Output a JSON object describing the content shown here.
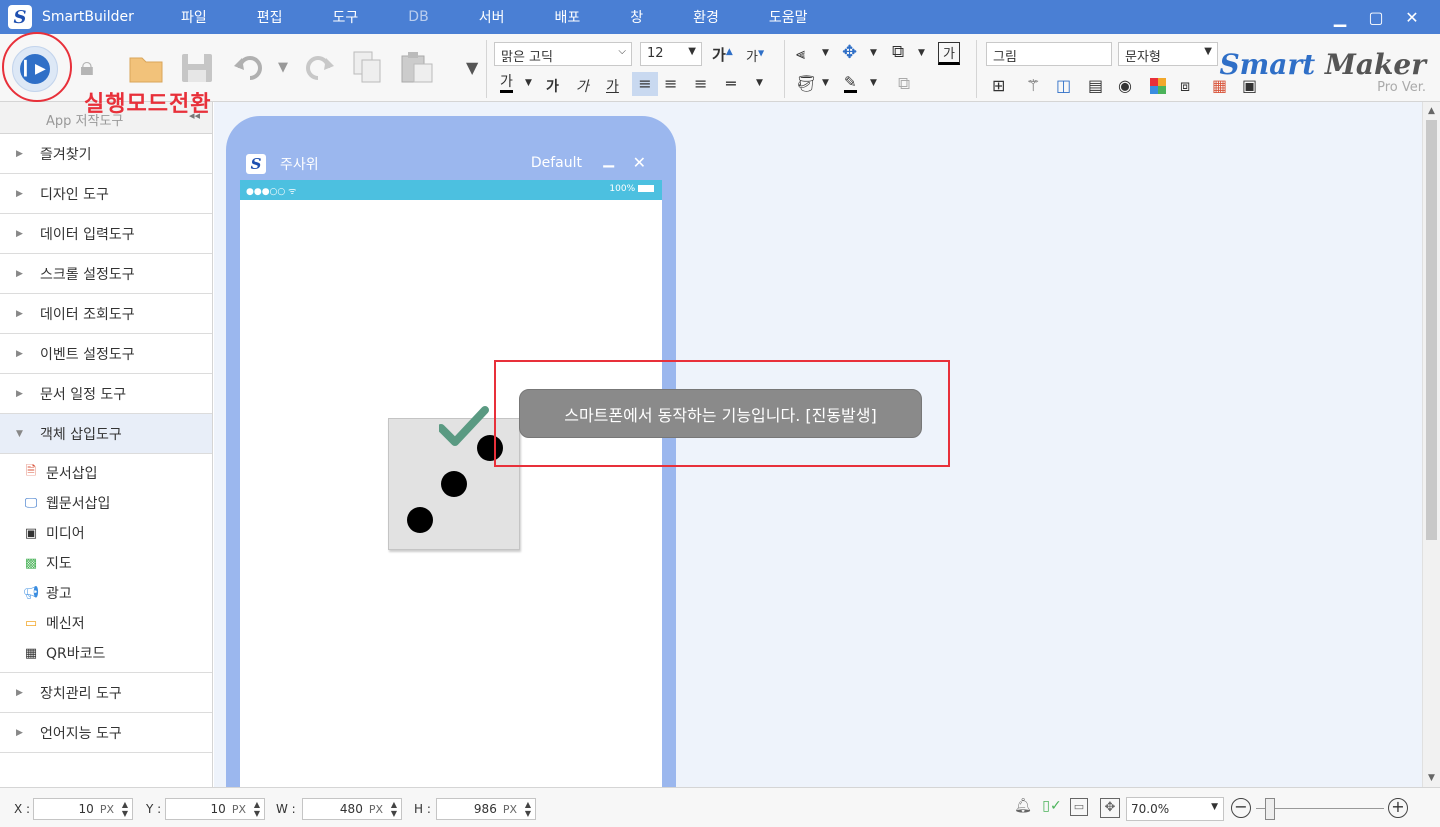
{
  "titlebar": {
    "app_title": "SmartBuilder",
    "menus": [
      "파일",
      "편집",
      "도구",
      "DB",
      "서버",
      "배포",
      "창",
      "환경",
      "도움말"
    ]
  },
  "toolbar": {
    "run_mode_annotation": "실행모드전환",
    "font_name": "맑은 고딕",
    "font_size": "12",
    "object_name": "그림",
    "object_type": "문자형",
    "bold_label": "가",
    "italic_label": "가",
    "underline_label": "가",
    "font_color_label": "가",
    "grow_label": "가",
    "shrink_label": "가",
    "text_bg_label": "가"
  },
  "logo": {
    "smart": "Smart",
    "maker": "Maker",
    "edition": "Pro Ver."
  },
  "sidebar": {
    "header": "App 저작도구",
    "categories_top": [
      "즐겨찾기",
      "디자인 도구",
      "데이터 입력도구",
      "스크롤 설정도구",
      "데이터 조회도구",
      "이벤트 설정도구",
      "문서 일정 도구"
    ],
    "open_category": "객체 삽입도구",
    "sub_items": [
      "문서삽입",
      "웹문서삽입",
      "미디어",
      "지도",
      "광고",
      "메신저",
      "QR바코드"
    ],
    "categories_bottom": [
      "장치관리 도구",
      "언어지능 도구"
    ]
  },
  "phone": {
    "title": "주사위",
    "profile": "Default",
    "status_left": "●●●○○ ᯤ",
    "status_right": "100%"
  },
  "toast": {
    "message": "스마트폰에서 동작하는 기능입니다. [진동발생]"
  },
  "statusbar": {
    "x_label": "X :",
    "x_value": "10",
    "y_label": "Y :",
    "y_value": "10",
    "w_label": "W :",
    "w_value": "480",
    "h_label": "H :",
    "h_value": "986",
    "unit": "PX",
    "zoom": "70.0%"
  },
  "colors": {
    "titlebar": "#4a7fd4",
    "accent_red": "#e8303a",
    "phone_frame": "#9bb7ee",
    "phone_status": "#4cc0e0",
    "check": "#5a9a82"
  }
}
